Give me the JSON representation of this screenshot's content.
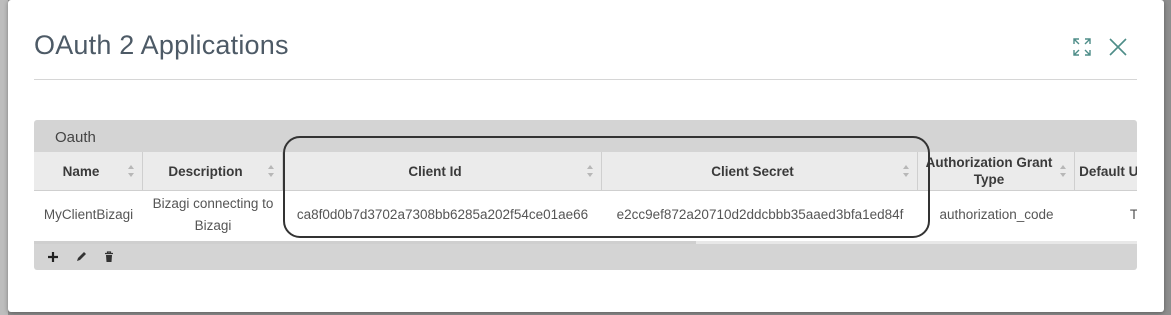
{
  "dialog": {
    "title": "OAuth 2 Applications",
    "icons": {
      "maximize": "expand-arrows-icon",
      "close": "close-x-icon"
    }
  },
  "panel": {
    "title": "Oauth",
    "columns": [
      "Name",
      "Description",
      "Client Id",
      "Client Secret",
      "Authorization Grant Type",
      "Default Username"
    ],
    "rows": [
      {
        "name": "MyClientBizagi",
        "description": "Bizagi connecting to Bizagi",
        "client_id": "ca8f0d0b7d3702a7308bb6285a202f54ce01ae66",
        "client_secret": "e2cc9ef872a20710d2ddcbbb35aaed3bfa1ed84f",
        "grant_type": "authorization_code",
        "default_username": "To"
      }
    ],
    "toolbar": {
      "add": "plus-icon",
      "edit": "pencil-icon",
      "delete": "trash-icon"
    }
  },
  "colors": {
    "title": "#4d5a66",
    "panel": "#d4d4d4",
    "header": "#ebebeb",
    "icon": "#4e8d88"
  }
}
